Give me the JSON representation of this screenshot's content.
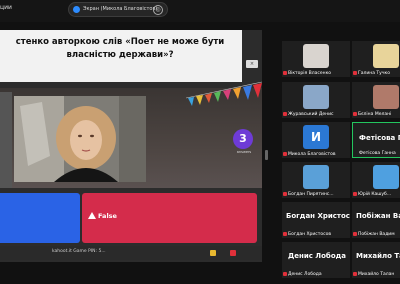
{
  "top_bar": {
    "left_text": "ции",
    "share_title": "Экран (Микола Благовістов)"
  },
  "slide": {
    "question": "стенко авторкою слів «Поет не може бути власністю держави»?",
    "countdown": "3",
    "countdown_label": "answers",
    "answer_false_label": "False"
  },
  "presenter_bar": {
    "text": "kahoot.it  Game PIN: 5..."
  },
  "gallery": {
    "tiles": [
      {
        "name": "Вікторія Власенко"
      },
      {
        "name": "Галина Тучко"
      },
      {
        "name": "Журавський Денис"
      },
      {
        "name": "Бєліна Мелані"
      },
      {
        "name": "Микола Благовістов",
        "initial": "И"
      },
      {
        "name": "Фетісова Ганна",
        "big_name": "Фетісова Га"
      },
      {
        "name": "Богдан Пирятинс..."
      },
      {
        "name": "Юрій Кашуб..."
      },
      {
        "name": "Богдан Христосов",
        "big_name": "Богдан Христосов"
      },
      {
        "name": "Побіжан Вадим",
        "big_name": "Побіжан Вади"
      },
      {
        "name": "Денис Лобода",
        "big_name": "Денис Лобода"
      },
      {
        "name": "Михайло Талан",
        "big_name": "Михайло Тала"
      }
    ]
  },
  "colors": {
    "true_answer": "#2a63e6",
    "false_answer": "#d42c4b",
    "countdown": "#6e3bd6",
    "active_speaker": "#23c55e"
  }
}
